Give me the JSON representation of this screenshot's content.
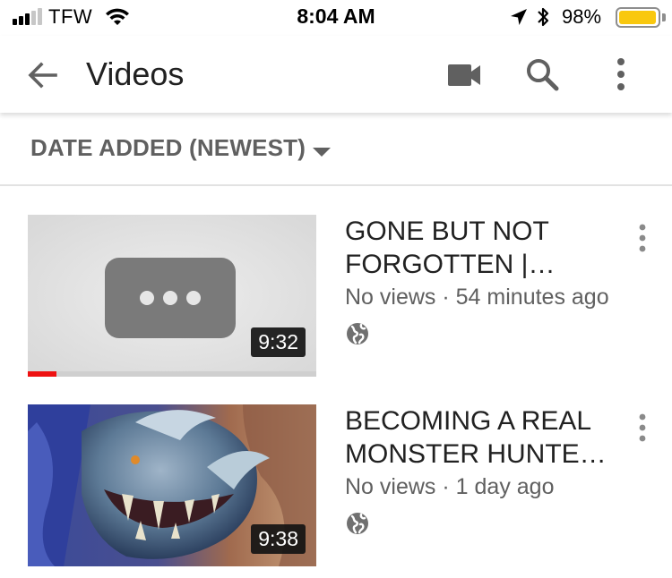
{
  "status_bar": {
    "carrier": "TFW",
    "time": "8:04 AM",
    "battery_percent": "98%",
    "battery_level": 0.98,
    "signal_bars_filled": 3,
    "signal_bars_total": 5,
    "battery_color": "#f9c80e",
    "icons": [
      "wifi-icon",
      "location-arrow-icon",
      "bluetooth-icon",
      "battery-icon"
    ]
  },
  "app_bar": {
    "title": "Videos",
    "icons": [
      "back-arrow-icon",
      "video-camera-icon",
      "search-icon",
      "more-vert-icon"
    ]
  },
  "sort": {
    "label": "DATE ADDED (NEWEST)",
    "icon": "caret-down-icon"
  },
  "videos": [
    {
      "title": "GONE BUT NOT FORGOTTEN | Fina…",
      "views": "No views",
      "age": "54 minutes ago",
      "duration": "9:32",
      "watched_fraction": 0.1,
      "privacy_icon": "globe-icon",
      "thumbnail": "processing-placeholder"
    },
    {
      "title": "BECOMING A REAL MONSTER HUNTE…",
      "views": "No views",
      "age": "1 day ago",
      "duration": "9:38",
      "watched_fraction": 0,
      "privacy_icon": "globe-icon",
      "thumbnail": "monster-artwork"
    }
  ],
  "colors": {
    "progress_red": "#ee1111",
    "secondary_text": "#606060"
  }
}
